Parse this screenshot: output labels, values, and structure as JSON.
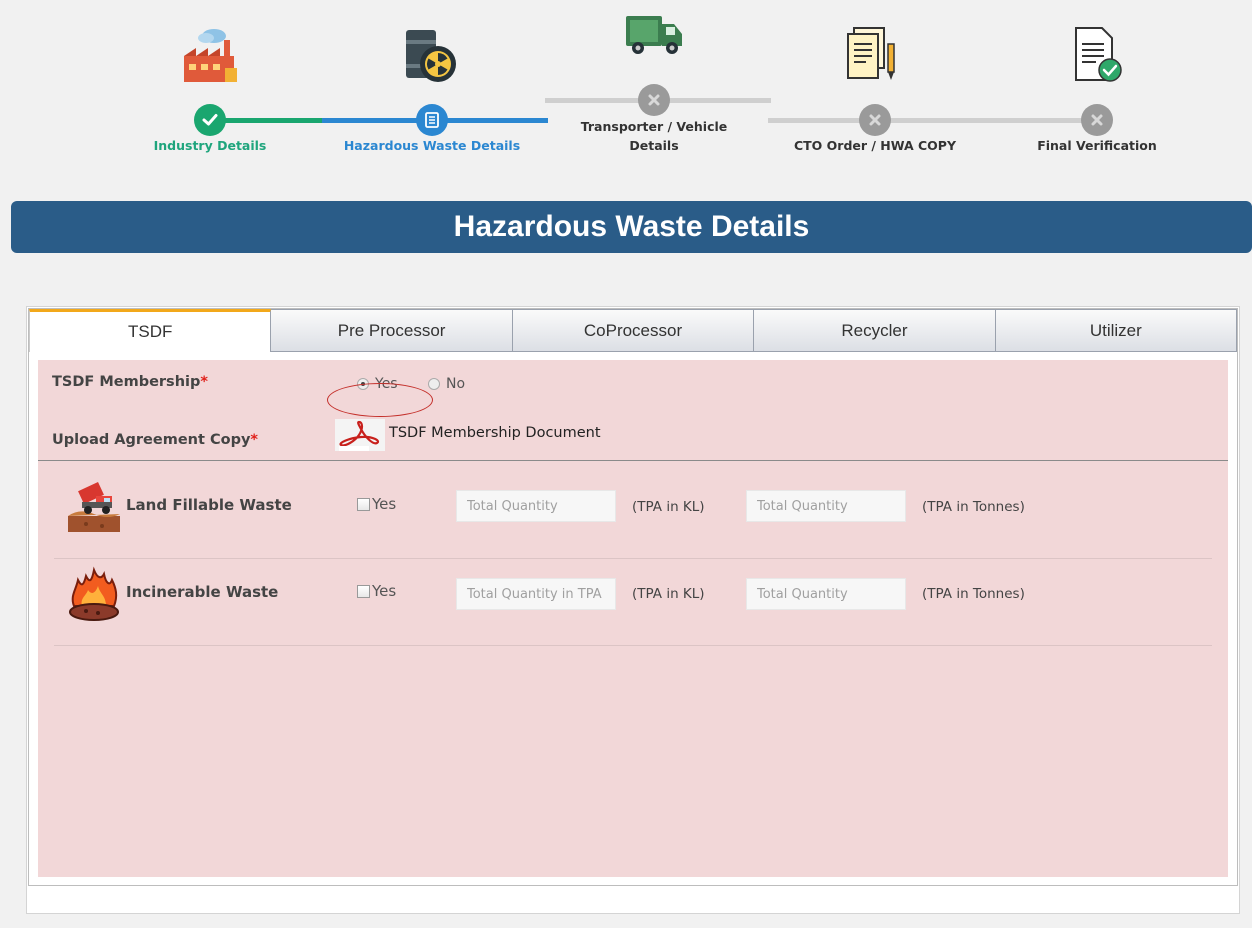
{
  "stepper": {
    "steps": [
      {
        "label": "Industry Details",
        "state": "done",
        "icon": "factory-icon",
        "node_icon": "check-icon"
      },
      {
        "label": "Hazardous Waste Details",
        "state": "active",
        "icon": "waste-barrel-icon",
        "node_icon": "list-icon"
      },
      {
        "label_line1": "Transporter / Vehicle",
        "label_line2": "Details",
        "state": "pending",
        "icon": "truck-icon",
        "node_icon": "close-icon"
      },
      {
        "label": "CTO Order / HWA COPY",
        "state": "pending",
        "icon": "documents-pen-icon",
        "node_icon": "close-icon"
      },
      {
        "label": "Final Verification",
        "state": "pending",
        "icon": "verified-document-icon",
        "node_icon": "close-icon"
      }
    ],
    "colors": {
      "done": "#1aa66f",
      "active": "#2b87d1",
      "pending": "#9a9a9a"
    }
  },
  "page": {
    "title": "Hazardous Waste Details",
    "header_color": "#2a5c88"
  },
  "tabs": [
    {
      "label": "TSDF",
      "active": true
    },
    {
      "label": "Pre Processor",
      "active": false
    },
    {
      "label": "CoProcessor",
      "active": false
    },
    {
      "label": "Recycler",
      "active": false
    },
    {
      "label": "Utilizer",
      "active": false
    }
  ],
  "tsdf": {
    "membership_label": "TSDF Membership",
    "required_mark": "*",
    "options": [
      {
        "label": "Yes",
        "checked": true
      },
      {
        "label": "No",
        "checked": false
      }
    ],
    "upload_label": "Upload Agreement Copy",
    "document_link": "TSDF Membership Document",
    "document_icon": "pdf-icon"
  },
  "waste_rows": [
    {
      "label": "Land Fillable Waste",
      "icon": "landfill-truck-icon",
      "checkbox_label": "Yes",
      "checked": false,
      "kl_placeholder": "Total Quantity",
      "kl_unit": "(TPA in KL)",
      "tonnes_placeholder": "Total Quantity",
      "tonnes_unit": "(TPA in Tonnes)"
    },
    {
      "label": "Incinerable Waste",
      "icon": "fire-waste-icon",
      "checkbox_label": "Yes",
      "checked": false,
      "kl_placeholder": "Total Quantity in TPA",
      "kl_unit": "(TPA in KL)",
      "tonnes_placeholder": "Total Quantity",
      "tonnes_unit": "(TPA in Tonnes)"
    }
  ]
}
